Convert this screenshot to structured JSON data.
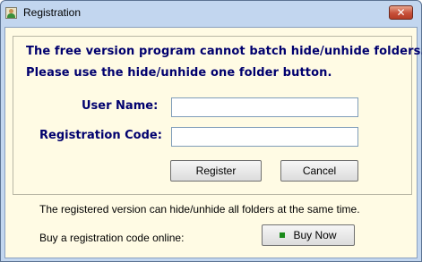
{
  "window": {
    "title": "Registration",
    "close_glyph": "✕",
    "icon_name": "user-app-icon"
  },
  "message": {
    "line1": "The free version program cannot batch hide/unhide folders.",
    "line2": "Please use the hide/unhide one folder button."
  },
  "form": {
    "username_label": "User Name:",
    "username_value": "",
    "regcode_label": "Registration Code:",
    "regcode_value": ""
  },
  "buttons": {
    "register": "Register",
    "cancel": "Cancel",
    "buy_now": "Buy Now"
  },
  "footer": {
    "info": "The registered version can hide/unhide all folders at the same time.",
    "buy_prompt": "Buy a  registration code online:"
  },
  "colors": {
    "window_frame": "#c2d6ef",
    "client_background": "#fffbe4",
    "label_text": "#00006e",
    "buy_indicator": "#1a8a1a"
  }
}
